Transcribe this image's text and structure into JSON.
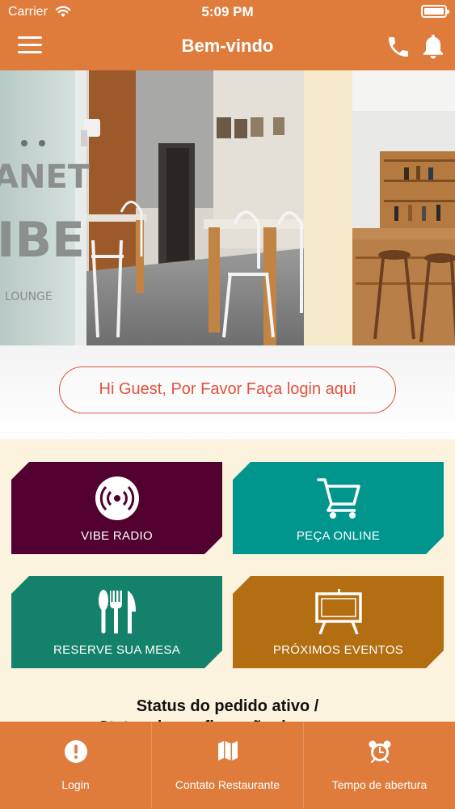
{
  "status_bar": {
    "carrier": "Carrier",
    "time": "5:09 PM"
  },
  "nav": {
    "title": "Bem-vindo",
    "icons": [
      "menu-icon",
      "phone-icon",
      "bell-icon"
    ]
  },
  "hero": {
    "sign_text": {
      "line1": "ANET",
      "line2": "IBE",
      "line3": "LOUNGE"
    },
    "login_banner": "Hi Guest, Por Favor Faça login aqui"
  },
  "tiles": [
    {
      "label": "VIBE RADIO",
      "icon": "radio-icon",
      "color": "#520030"
    },
    {
      "label": "PEÇA ONLINE",
      "icon": "cart-icon",
      "color": "#00968d"
    },
    {
      "label": "RESERVE SUA MESA",
      "icon": "cutlery-icon",
      "color": "#14826a"
    },
    {
      "label": "PRÓXIMOS EVENTOS",
      "icon": "easel-icon",
      "color": "#b26e10"
    }
  ],
  "order_status": {
    "line1": "Status do pedido ativo /",
    "line2": "Status da confirmação da reserva"
  },
  "tabbar": [
    {
      "label": "Login",
      "icon": "alert-circle-icon"
    },
    {
      "label": "Contato Restaurante",
      "icon": "map-icon"
    },
    {
      "label": "Tempo de abertura",
      "icon": "alarm-clock-icon"
    }
  ],
  "colors": {
    "primary": "#df7c3c",
    "banner_accent": "#e0533f",
    "background": "#fbf3dd"
  }
}
